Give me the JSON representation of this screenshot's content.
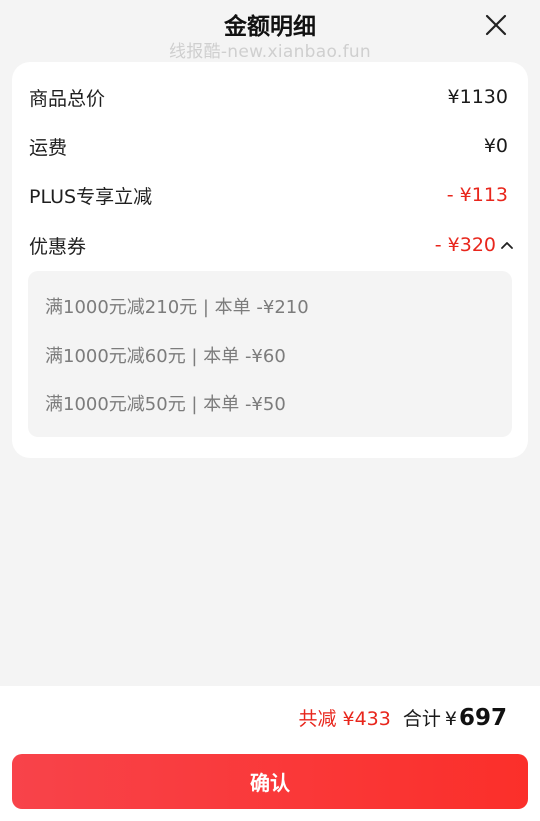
{
  "header": {
    "title": "金额明细",
    "watermark": "线报酷-new.xianbao.fun",
    "close_icon": "close-icon"
  },
  "details": {
    "rows": [
      {
        "label": "商品总价",
        "value": "¥1130"
      },
      {
        "label": "运费",
        "value": "¥0"
      },
      {
        "label": "PLUS专享立减",
        "value": "- ¥113"
      },
      {
        "label": "优惠券",
        "value": "- ¥320"
      }
    ],
    "coupon_toggle_icon": "chevron-up-icon",
    "coupons": [
      "满1000元减210元 | 本单 -¥210",
      "满1000元减60元 | 本单 -¥60",
      "满1000元减50元 | 本单 -¥50"
    ]
  },
  "footer": {
    "discount": "共减 ¥433",
    "total_label": "合计",
    "total_currency": "¥",
    "total_value": "697",
    "confirm_label": "确认"
  },
  "colors": {
    "accent_red": "#e8261c",
    "button_gradient_start": "#f8434a",
    "button_gradient_end": "#fb2f2a",
    "background": "#f4f4f4"
  }
}
